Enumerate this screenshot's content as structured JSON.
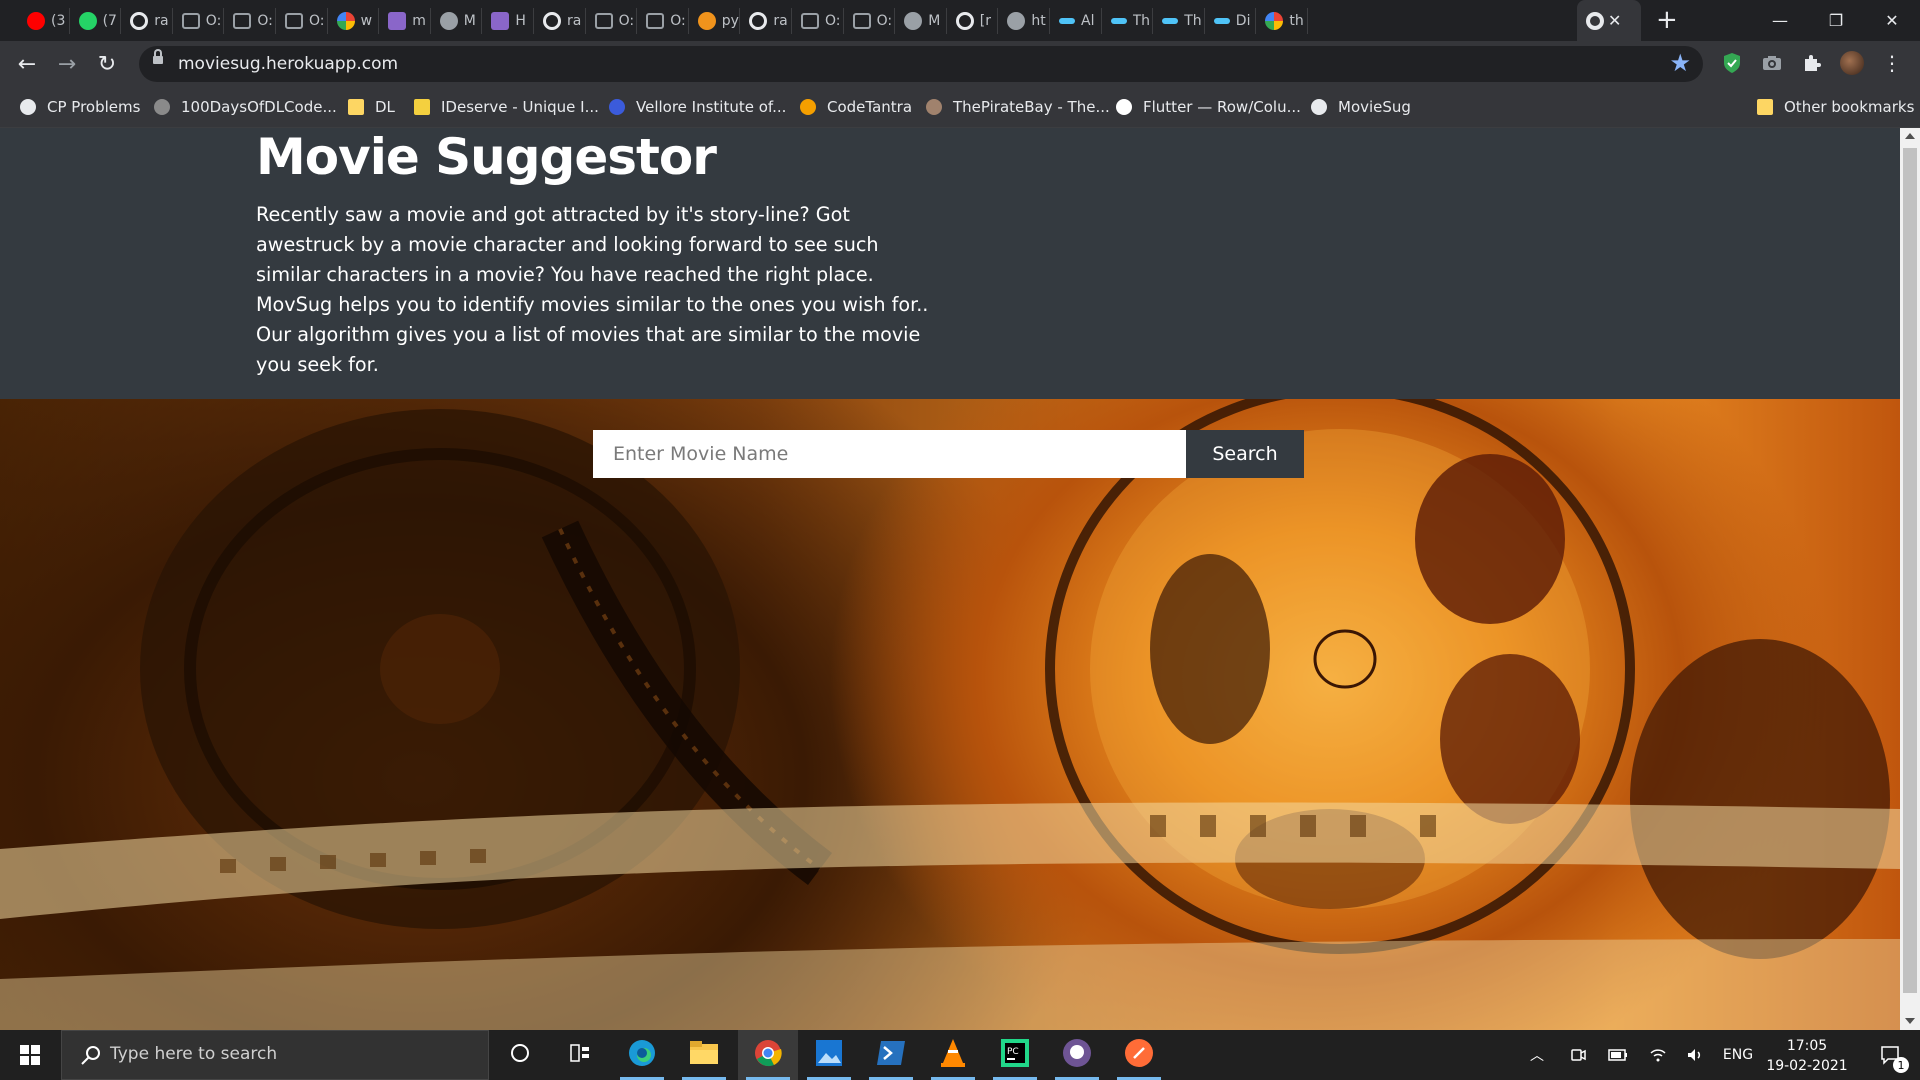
{
  "browser": {
    "tabs": [
      {
        "title": "(3",
        "icon": "youtube-icon"
      },
      {
        "title": "(7",
        "icon": "whatsapp-icon"
      },
      {
        "title": "ra",
        "icon": "github-icon"
      },
      {
        "title": "O:",
        "icon": "window-icon"
      },
      {
        "title": "O:",
        "icon": "window-icon"
      },
      {
        "title": "O:",
        "icon": "window-icon"
      },
      {
        "title": "w",
        "icon": "google-icon"
      },
      {
        "title": "m",
        "icon": "heroku-icon"
      },
      {
        "title": "M",
        "icon": "globe-icon"
      },
      {
        "title": "H",
        "icon": "heroku-icon"
      },
      {
        "title": "ra",
        "icon": "github-icon"
      },
      {
        "title": "O:",
        "icon": "window-icon"
      },
      {
        "title": "O:",
        "icon": "window-icon"
      },
      {
        "title": "py",
        "icon": "java-icon"
      },
      {
        "title": "ra",
        "icon": "github-icon"
      },
      {
        "title": "O:",
        "icon": "window-icon"
      },
      {
        "title": "O:",
        "icon": "window-icon"
      },
      {
        "title": "M",
        "icon": "globe-icon"
      },
      {
        "title": "[r",
        "icon": "github-icon"
      },
      {
        "title": "ht",
        "icon": "globe-icon"
      },
      {
        "title": "Al",
        "icon": "dash-icon"
      },
      {
        "title": "Th",
        "icon": "dash-icon"
      },
      {
        "title": "Th",
        "icon": "dash-icon"
      },
      {
        "title": "Di",
        "icon": "dash-icon"
      },
      {
        "title": "th",
        "icon": "google-icon"
      }
    ],
    "active_tab_icon": "globe-icon",
    "url": "moviesug.herokuapp.com",
    "bookmarks": [
      {
        "label": "CP Problems",
        "icon": "globe-icon"
      },
      {
        "label": "100DaysOfDLCode...",
        "icon": "user-icon"
      },
      {
        "label": "DL",
        "icon": "folder-icon"
      },
      {
        "label": "IDeserve - Unique I...",
        "icon": "ideserve-icon"
      },
      {
        "label": "Vellore Institute of...",
        "icon": "vit-icon"
      },
      {
        "label": "CodeTantra",
        "icon": "codetantra-icon"
      },
      {
        "label": "ThePirateBay - The...",
        "icon": "ship-icon"
      },
      {
        "label": "Flutter — Row/Colu...",
        "icon": "medium-icon"
      },
      {
        "label": "MovieSug",
        "icon": "globe-icon"
      }
    ],
    "other_bookmarks": "Other bookmarks",
    "colors": {
      "accent": "#8ab4f8",
      "tabstrip": "#202124",
      "toolbar": "#35363a"
    }
  },
  "page": {
    "title": "Movie Suggestor",
    "description": "Recently saw a movie and got attracted by it's story-line? Got awestruck by a movie character and looking forward to see such similar characters in a movie? You have reached the right place. MovSug helps you to identify movies similar to the ones you wish for.. Our algorithm gives you a list of movies that are similar to the movie you seek for.",
    "search": {
      "placeholder": "Enter Movie Name",
      "value": "",
      "button_label": "Search"
    },
    "colors": {
      "hero_bg": "#343a40",
      "banner": "#e88a22"
    }
  },
  "taskbar": {
    "search_placeholder": "Type here to search",
    "apps": [
      "cortana-icon",
      "task-view-icon",
      "edge-icon",
      "file-explorer-icon",
      "chrome-icon",
      "photos-icon",
      "powershell-icon",
      "vlc-icon",
      "pycharm-icon",
      "github-desktop-icon",
      "postman-icon"
    ],
    "language": "ENG",
    "time": "17:05",
    "date": "19-02-2021",
    "notification_count": "1"
  }
}
